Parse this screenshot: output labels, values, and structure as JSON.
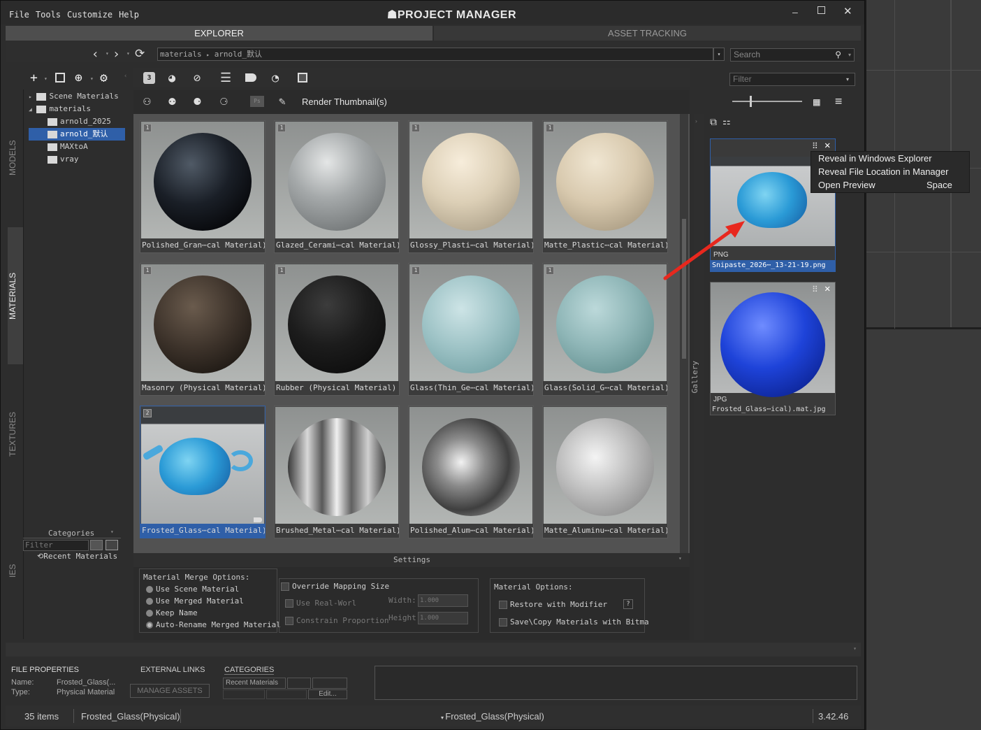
{
  "app": {
    "title": "PROJECT MANAGER",
    "menu": [
      "File",
      "Tools",
      "Customize",
      "Help"
    ]
  },
  "tabs": {
    "explorer": "EXPLORER",
    "asset_tracking": "ASSET TRACKING"
  },
  "path": {
    "segment1": "materials",
    "segment2": "arnold_默认"
  },
  "search": {
    "placeholder": "Search"
  },
  "filter": {
    "placeholder": "Filter"
  },
  "toolbar": {
    "render_thumbnails": "Render Thumbnail(s)"
  },
  "side_tabs": {
    "models": "MODELS",
    "materials": "MATERIALS",
    "textures": "TEXTURES",
    "ies": "IES"
  },
  "tree": {
    "scene_materials": "Scene Materials",
    "materials": "materials",
    "children": [
      "arnold_2025",
      "arnold_默认",
      "MAXtoA",
      "vray"
    ]
  },
  "categories": {
    "title": "Categories",
    "filter": "Filter",
    "recent": "Recent Materials"
  },
  "grid": [
    {
      "num": "1",
      "caption": "Polished_Gran⋯cal Material)"
    },
    {
      "num": "1",
      "caption": "Glazed_Cerami⋯cal Material)"
    },
    {
      "num": "1",
      "caption": "Glossy_Plasti⋯cal Material)"
    },
    {
      "num": "1",
      "caption": "Matte_Plastic⋯cal Material)"
    },
    {
      "num": "1",
      "caption": "Masonry (Physical Material)"
    },
    {
      "num": "1",
      "caption": "Rubber (Physical Material)"
    },
    {
      "num": "1",
      "caption": "Glass(Thin_Ge⋯cal Material)"
    },
    {
      "num": "1",
      "caption": "Glass(Solid_G⋯cal Material)"
    },
    {
      "num": "2",
      "caption": "Frosted_Glass⋯cal Material)"
    },
    {
      "num": "",
      "caption": "Brushed_Metal⋯cal Material)"
    },
    {
      "num": "",
      "caption": "Polished_Alum⋯cal Material)"
    },
    {
      "num": "",
      "caption": "Matte_Aluminu⋯cal Material)"
    }
  ],
  "gallery": {
    "label": "Gallery",
    "items": [
      {
        "type": "PNG",
        "caption": "Snipaste_2026⋯_13-21-19.png"
      },
      {
        "type": "JPG",
        "caption": "Frosted_Glass⋯ical).mat.jpg"
      }
    ]
  },
  "context_menu": {
    "items": [
      {
        "label": "Reveal in Windows Explorer",
        "shortcut": ""
      },
      {
        "label": "Reveal File Location in Manager",
        "shortcut": ""
      },
      {
        "label": "Open Preview",
        "shortcut": "Space"
      }
    ]
  },
  "settings": {
    "title": "Settings",
    "merge_title": "Material Merge Options:",
    "merge_options": [
      "Use Scene Material",
      "Use Merged Material",
      "Keep Name",
      "Auto-Rename Merged Material"
    ],
    "override": "Override Mapping Size",
    "use_real_world": "Use Real-Worl",
    "constrain": "Constrain Proportion",
    "width_label": "Width:",
    "height_label": "Height:",
    "width_val": "1.000",
    "height_val": "1.000",
    "mat_options_title": "Material Options:",
    "restore": "Restore with Modifier",
    "help": "?",
    "save_copy": "Save\\Copy Materials with Bitma"
  },
  "props": {
    "file_props": "FILE PROPERTIES",
    "name_label": "Name:",
    "name_val": "Frosted_Glass(...",
    "type_label": "Type:",
    "type_val": "Physical Material",
    "external_links": "EXTERNAL LINKS",
    "manage_assets": "MANAGE ASSETS",
    "categories": "CATEGORIES",
    "recent": "Recent Materials",
    "edit": "Edit..."
  },
  "status": {
    "items": "35 items",
    "selected": "Frosted_Glass(Physical)",
    "center": "Frosted_Glass(Physical)",
    "version": "3.42.46"
  }
}
